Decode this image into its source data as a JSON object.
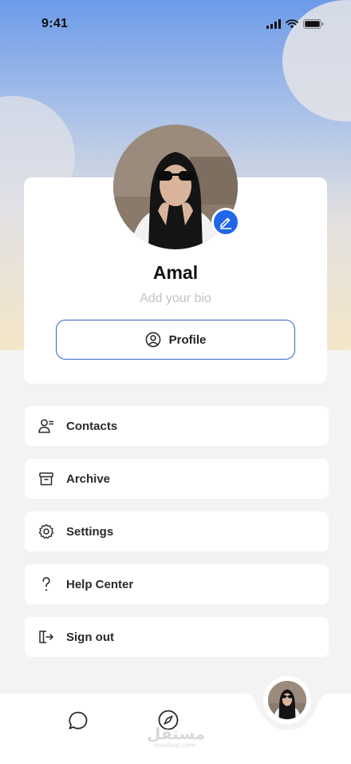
{
  "status_bar": {
    "time": "9:41"
  },
  "profile": {
    "name": "Amal",
    "bio_placeholder": "Add your bio",
    "profile_button_label": "Profile"
  },
  "menu": [
    {
      "label": "Contacts",
      "icon": "contacts-icon"
    },
    {
      "label": "Archive",
      "icon": "archive-icon"
    },
    {
      "label": "Settings",
      "icon": "settings-icon"
    },
    {
      "label": "Help Center",
      "icon": "help-icon"
    },
    {
      "label": "Sign out",
      "icon": "sign-out-icon"
    }
  ],
  "bottom_nav": [
    {
      "icon": "chat-icon"
    },
    {
      "icon": "compass-icon"
    },
    {
      "icon": "profile-avatar"
    }
  ],
  "watermark": {
    "main": "مستقل",
    "sub": "mostaql.com"
  },
  "colors": {
    "accent": "#2166e8",
    "button_border": "#2d66c6",
    "gradient_top": "#6c9be9",
    "gradient_bottom": "#f4e6c7",
    "page_bg": "#f3f3f4"
  }
}
